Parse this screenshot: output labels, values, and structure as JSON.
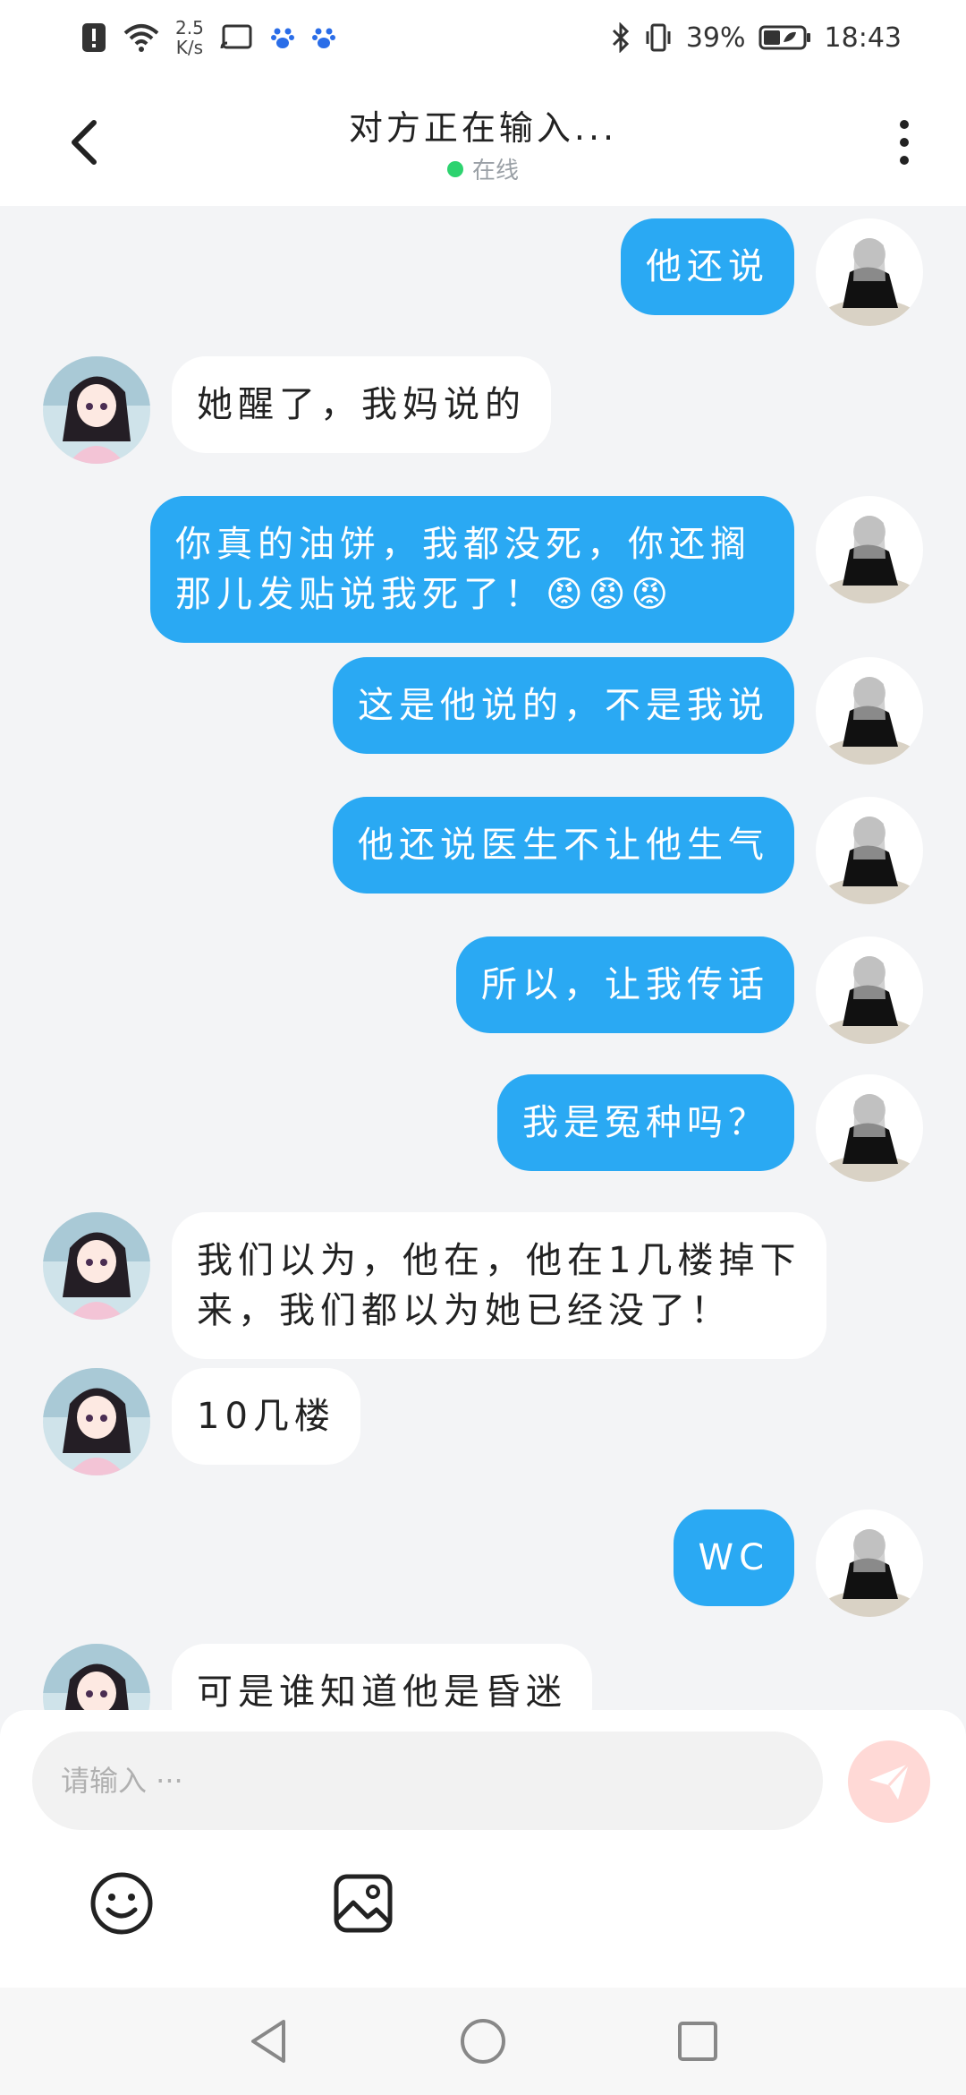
{
  "status_bar": {
    "speed_value": "2.5",
    "speed_unit": "K/s",
    "battery": "39%",
    "time": "18:43"
  },
  "header": {
    "title": "对方正在输入...",
    "status": "在线"
  },
  "messages": [
    {
      "side": "right",
      "text": "他还说"
    },
    {
      "side": "left",
      "text": "她醒了，我妈说的"
    },
    {
      "side": "right",
      "text": "你真的油饼，我都没死，你还搁那儿发贴说我死了！😡😡😡"
    },
    {
      "side": "right",
      "text": "这是他说的，不是我说"
    },
    {
      "side": "right",
      "text": "他还说医生不让他生气"
    },
    {
      "side": "right",
      "text": "所以，让我传话"
    },
    {
      "side": "right",
      "text": "我是冤种吗？"
    },
    {
      "side": "left",
      "text": "我们以为，他在，他在1几楼掉下来，我们都以为她已经没了！"
    },
    {
      "side": "left",
      "text": "10几楼"
    },
    {
      "side": "right",
      "text": "WC"
    },
    {
      "side": "left",
      "text": "可是谁知道他是昏迷"
    }
  ],
  "input": {
    "placeholder": "请输入 ···"
  },
  "colors": {
    "outgoing_bubble": "#2aa9f3",
    "incoming_bubble": "#ffffff",
    "online_dot": "#2dd36f",
    "send_button": "#ffd9d6"
  },
  "icons": {
    "back": "back-arrow-icon",
    "more": "more-vertical-icon",
    "send": "send-icon",
    "emoji": "emoji-icon",
    "image": "image-icon"
  }
}
